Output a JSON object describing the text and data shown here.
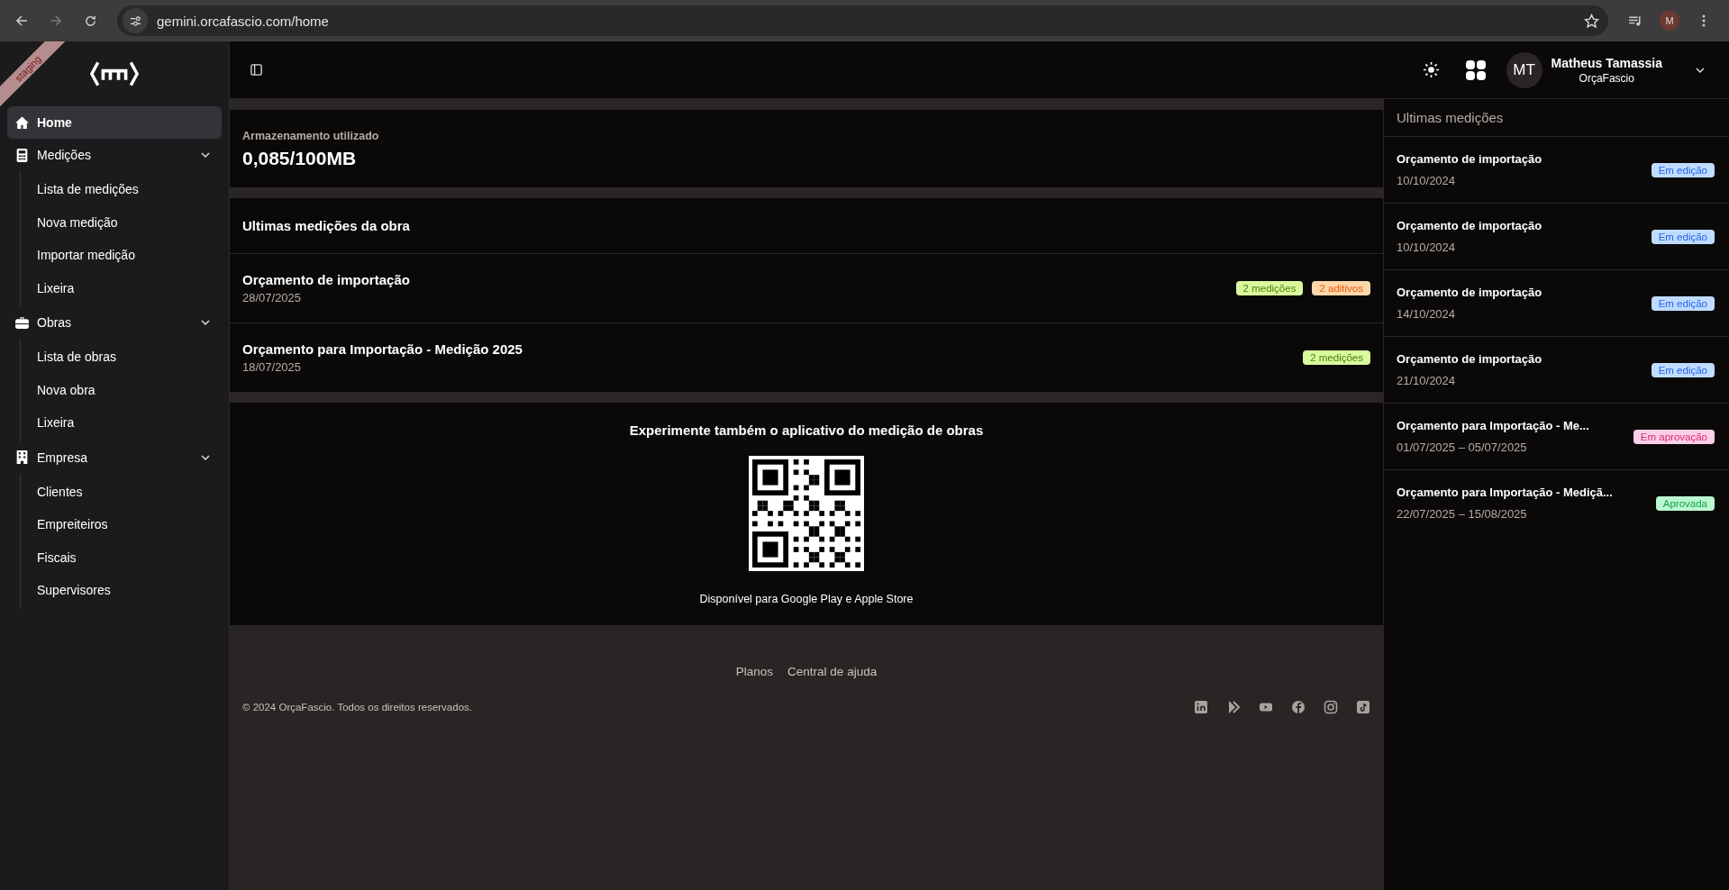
{
  "browser": {
    "url": "gemini.orcafascio.com/home",
    "profile_initial": "M"
  },
  "sidebar": {
    "ribbon": "staging",
    "items": [
      {
        "label": "Home",
        "selected": true
      },
      {
        "label": "Medições",
        "selected": false,
        "expanded": true,
        "children": [
          {
            "label": "Lista de medições"
          },
          {
            "label": "Nova medição"
          },
          {
            "label": "Importar medição"
          },
          {
            "label": "Lixeira"
          }
        ]
      },
      {
        "label": "Obras",
        "selected": false,
        "expanded": true,
        "children": [
          {
            "label": "Lista de obras"
          },
          {
            "label": "Nova obra"
          },
          {
            "label": "Lixeira"
          }
        ]
      },
      {
        "label": "Empresa",
        "selected": false,
        "expanded": true,
        "children": [
          {
            "label": "Clientes"
          },
          {
            "label": "Empreiteiros"
          },
          {
            "label": "Fiscais"
          },
          {
            "label": "Supervisores"
          }
        ]
      }
    ]
  },
  "user": {
    "initials": "MT",
    "name": "Matheus Tamassia",
    "company": "OrçaFascio"
  },
  "storage": {
    "label": "Armazenamento utilizado",
    "value": "0,085/100MB"
  },
  "recent_project": {
    "title": "Ultimas medições da obra",
    "items": [
      {
        "title": "Orçamento de importação",
        "date": "28/07/2025",
        "tags": [
          {
            "label": "2 medições",
            "kind": "measurements"
          },
          {
            "label": "2 aditivos",
            "kind": "additives"
          }
        ]
      },
      {
        "title": "Orçamento para Importação - Medição 2025",
        "date": "18/07/2025",
        "tags": [
          {
            "label": "2 medições",
            "kind": "measurements"
          }
        ]
      }
    ]
  },
  "app_promo": {
    "title": "Experimente também o aplicativo do medição de obras",
    "caption": "Disponível para Google Play e Apple Store"
  },
  "footer": {
    "links": [
      "Planos",
      "Central de ajuda"
    ],
    "copyright": "© 2024 OrçaFascio. Todos os direitos reservados."
  },
  "recent_panel": {
    "title": "Ultimas medições",
    "items": [
      {
        "title": "Orçamento de importação",
        "date": "10/10/2024",
        "status": "Em edição",
        "kind": "editing"
      },
      {
        "title": "Orçamento de importação",
        "date": "10/10/2024",
        "status": "Em edição",
        "kind": "editing"
      },
      {
        "title": "Orçamento de importação",
        "date": "14/10/2024",
        "status": "Em edição",
        "kind": "editing"
      },
      {
        "title": "Orçamento de importação",
        "date": "21/10/2024",
        "status": "Em edição",
        "kind": "editing"
      },
      {
        "title": "Orçamento para Importação - Me...",
        "date": "01/07/2025 – 05/07/2025",
        "status": "Em aprovação",
        "kind": "approval"
      },
      {
        "title": "Orçamento para Importação - Mediçã...",
        "date": "22/07/2025 – 15/08/2025",
        "status": "Aprovada",
        "kind": "approved"
      }
    ]
  }
}
